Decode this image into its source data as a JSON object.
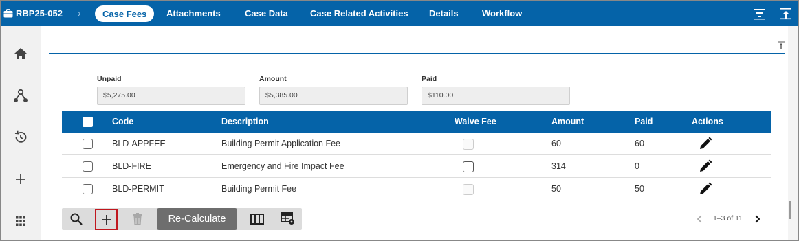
{
  "header": {
    "case_id": "RBP25-052",
    "tabs": [
      {
        "label": "Case Fees",
        "active": true
      },
      {
        "label": "Attachments"
      },
      {
        "label": "Case Data"
      },
      {
        "label": "Case Related Activities"
      },
      {
        "label": "Details"
      },
      {
        "label": "Workflow"
      }
    ],
    "right_icons": [
      "filter-icon",
      "collapse-all-icon"
    ]
  },
  "sidebar": {
    "icons": [
      "home-icon",
      "people-hierarchy-icon",
      "history-icon",
      "add-icon",
      "apps-grid-icon"
    ]
  },
  "summary": {
    "unpaid_label": "Unpaid",
    "unpaid_value": "$5,275.00",
    "amount_label": "Amount",
    "amount_value": "$5,385.00",
    "paid_label": "Paid",
    "paid_value": "$110.00"
  },
  "grid": {
    "columns": {
      "code": "Code",
      "description": "Description",
      "waive_fee": "Waive Fee",
      "amount": "Amount",
      "paid": "Paid",
      "actions": "Actions"
    },
    "rows": [
      {
        "code": "BLD-APPFEE",
        "description": "Building Permit Application Fee",
        "waive_enabled": false,
        "amount": "60",
        "paid": "60"
      },
      {
        "code": "BLD-FIRE",
        "description": "Emergency and Fire Impact Fee",
        "waive_enabled": true,
        "amount": "314",
        "paid": "0"
      },
      {
        "code": "BLD-PERMIT",
        "description": "Building Permit Fee",
        "waive_enabled": false,
        "amount": "50",
        "paid": "50"
      }
    ]
  },
  "toolbar": {
    "recalculate_label": "Re-Calculate",
    "buttons": [
      "search-icon",
      "add-icon",
      "delete-icon",
      "columns-icon",
      "grid-settings-icon"
    ]
  },
  "pager": {
    "text": "1–3 of 11"
  },
  "colors": {
    "brand_blue": "#0563a8",
    "highlight_red": "#c0171e"
  }
}
